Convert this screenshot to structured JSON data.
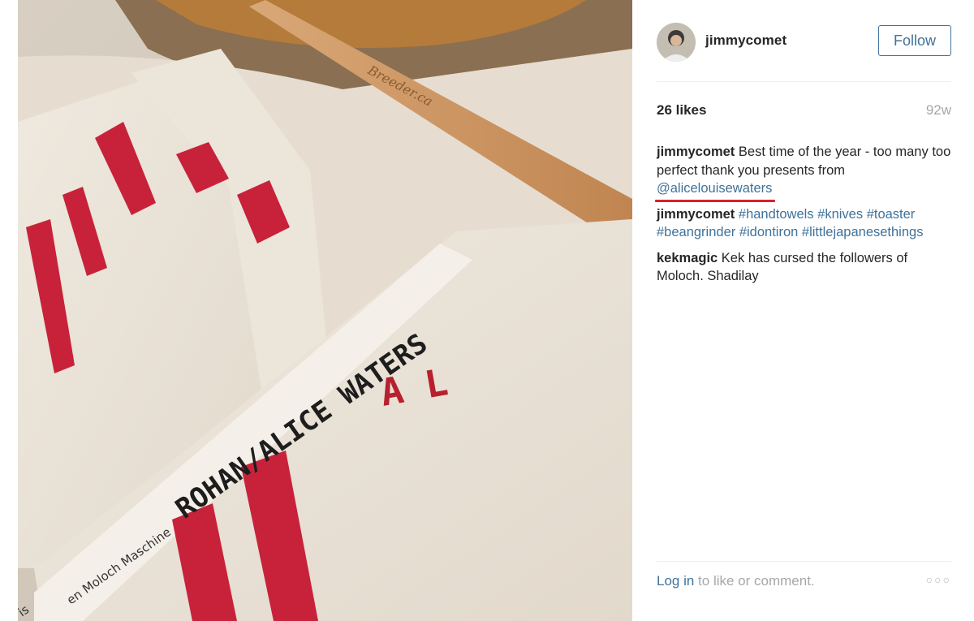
{
  "post": {
    "photo_handwriting": "ROHAN/ALICE WATERS",
    "photo_monogram": "A L",
    "photo_card_text": "en Moloch Maschine",
    "photo_card_text2": "is",
    "photo_pin_text": "Breeder.ca"
  },
  "header": {
    "username": "jimmycomet",
    "follow_label": "Follow"
  },
  "stats": {
    "likes": "26 likes",
    "time": "92w"
  },
  "comments": [
    {
      "user": "jimmycomet",
      "text": " Best time of the year - too many too perfect thank you presents from ",
      "mention": "@alicelouisewaters"
    },
    {
      "user": "jimmycomet",
      "tags": [
        "#handtowels",
        "#knives",
        "#toaster",
        "#beangrinder",
        "#idontiron",
        "#littlejapanesethings"
      ]
    },
    {
      "user": "kekmagic",
      "text": " Kek has cursed the followers of Moloch. Shadilay"
    }
  ],
  "footer": {
    "login_label": "Log in",
    "login_rest": " to like or comment.",
    "more_icon": "more-dots-icon"
  },
  "colors": {
    "link": "#3f729b",
    "text": "#262626",
    "muted": "#a5a7aa",
    "highlight_underline": "#d9202a"
  }
}
